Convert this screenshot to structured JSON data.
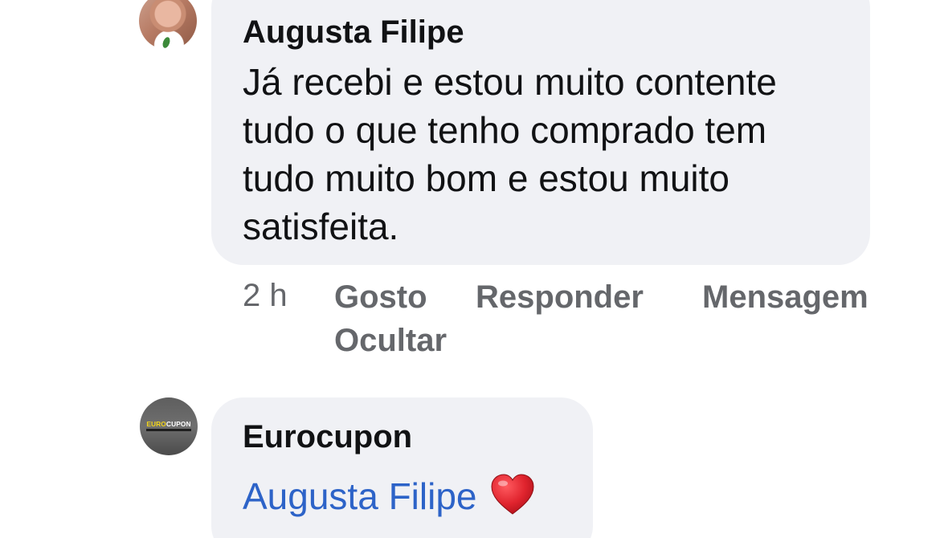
{
  "comments": [
    {
      "author": "Augusta Filipe",
      "text_lines": [
        "Já recebi e estou muito contente",
        "tudo o que tenho comprado tem",
        "tudo muito bom e estou muito",
        "satisfeita."
      ],
      "time": "2 h",
      "actions": {
        "like": "Gosto",
        "reply": "Responder",
        "message": "Mensagem",
        "hide": "Ocultar"
      }
    },
    {
      "author": "Eurocupon",
      "avatar_text": {
        "part1": "EURO",
        "part2": "CUPON"
      },
      "mention": "Augusta Filipe",
      "emoji": "heart-icon"
    }
  ],
  "colors": {
    "bubble": "#f0f1f5",
    "meta_text": "#65676b",
    "mention": "#2d63c8",
    "heart": "#e0242e"
  }
}
